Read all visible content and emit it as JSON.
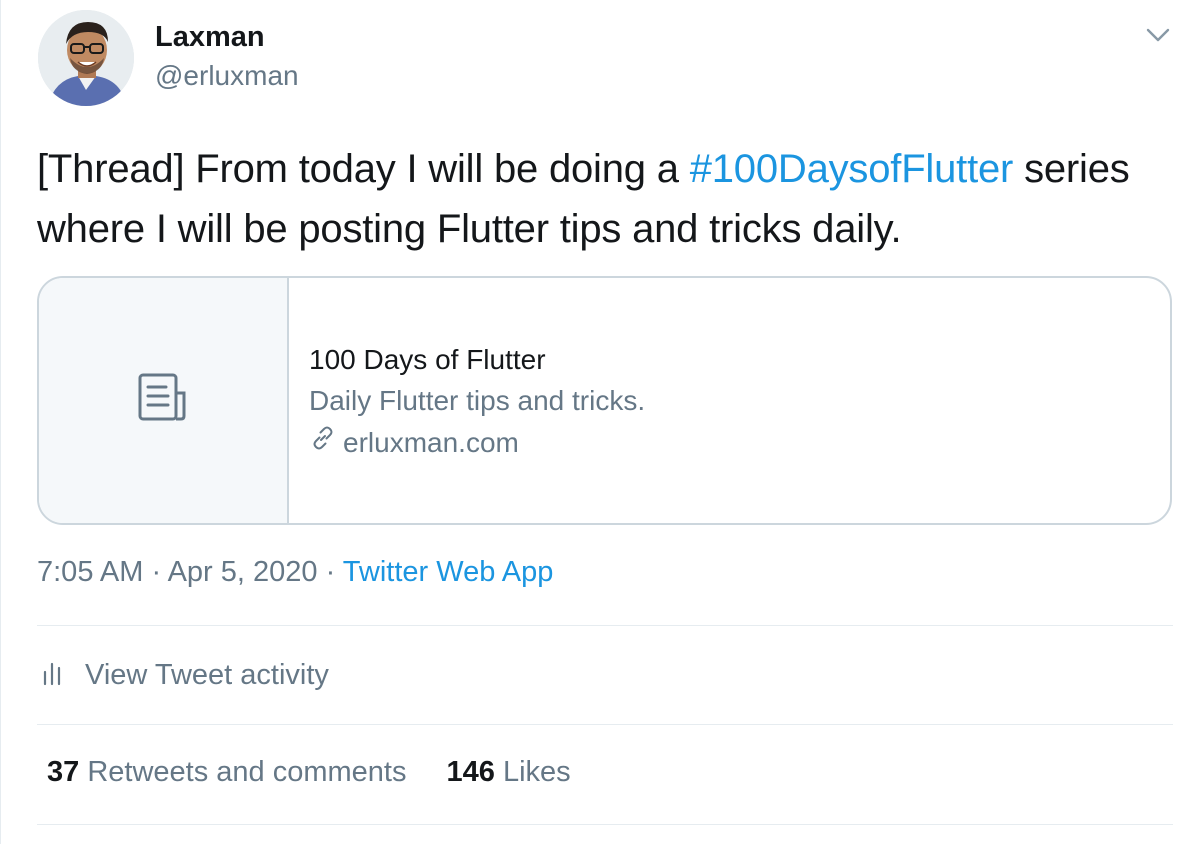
{
  "author": {
    "name": "Laxman",
    "handle": "@erluxman"
  },
  "tweet": {
    "text_before": "[Thread] From today I will be doing a ",
    "hashtag": "#100DaysofFlutter",
    "text_after": " series where I will be posting Flutter tips and tricks daily."
  },
  "card": {
    "title": "100 Days of Flutter",
    "description": "Daily Flutter tips and tricks.",
    "domain": "erluxman.com",
    "icon": "article-icon"
  },
  "meta": {
    "time": "7:05 AM",
    "separator": " · ",
    "date": "Apr 5, 2020",
    "source": "Twitter Web App"
  },
  "activity": {
    "label": "View Tweet activity",
    "icon": "bar-chart-icon"
  },
  "stats": {
    "retweets_count": "37",
    "retweets_label": "Retweets and comments",
    "likes_count": "146",
    "likes_label": "Likes"
  },
  "colors": {
    "link": "#1b95e0",
    "secondary_text": "#657786",
    "primary_text": "#14171a",
    "border": "#ccd6dd"
  }
}
